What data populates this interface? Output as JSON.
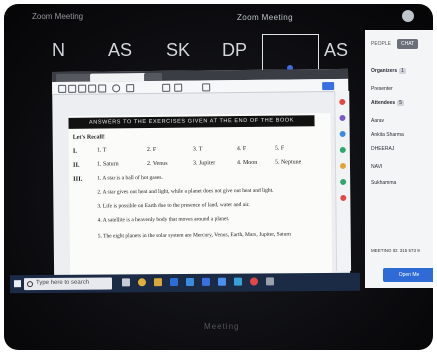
{
  "meeting": {
    "app_title": "Zoom Meeting",
    "title": "Zoom Meeting",
    "bottom_label": "Meeting",
    "tiles": [
      "N",
      "AS",
      "SK",
      "DP",
      "AS"
    ],
    "colors": {
      "panel_bg": "#f4f5f7",
      "accent": "#2f6bd6"
    }
  },
  "panel": {
    "tab_people": "PEOPLE",
    "tab_chat": "CHAT",
    "organizers_label": "Organizers",
    "organizers_count": "1",
    "presenter_label": "Presenter",
    "attendees_label": "Attendees",
    "attendees_count": "5",
    "attendees": [
      "Aarav",
      "Ankita Sharma",
      "DHEERAJ",
      "NAVI",
      "Sukhamma"
    ],
    "meeting_id": "MEETING ID: 315 573 9",
    "open_button": "Open Me"
  },
  "browser": {
    "tabs": [
      "",
      "",
      ""
    ],
    "toolbar_icons": [
      "back-icon",
      "forward-icon",
      "home-icon",
      "print-icon",
      "save-icon",
      "zoom-icon",
      "undo-icon",
      "cursor-icon",
      "text-icon",
      "highlight-icon",
      "share-icon"
    ]
  },
  "pdf": {
    "banner": "ANSWERS TO THE EXERCISES GIVEN AT THE END OF THE BOOK",
    "lets_recall": "Let's Recall!",
    "section_I": {
      "num": "I.",
      "items": [
        "1. T",
        "2. F",
        "3. T",
        "4. F",
        "5. F"
      ]
    },
    "section_II": {
      "num": "II.",
      "items": [
        "1. Saturn",
        "2. Venus",
        "3. Jupiter",
        "4. Moon",
        "5. Neptune"
      ]
    },
    "section_III": {
      "num": "III.",
      "lines": [
        "1. A star is a ball of hot gases.",
        "2. A star gives out heat and light, while a planet does not give out heat and light.",
        "3. Life is possible on Earth due to the presence of land, water and air.",
        "4. A satellite is a heavenly body that moves around a planet.",
        "5. The eight planets in the solar system are Mercury, Venus, Earth, Mars, Jupiter, Saturn"
      ]
    }
  },
  "taskbar": {
    "search_placeholder": "Type here to search",
    "icons": [
      "task-view-icon",
      "chrome-icon",
      "file-explorer-icon",
      "word-icon",
      "store-icon",
      "mail-icon",
      "zoom-icon",
      "browser-icon",
      "chrome-icon",
      "settings-icon"
    ]
  }
}
